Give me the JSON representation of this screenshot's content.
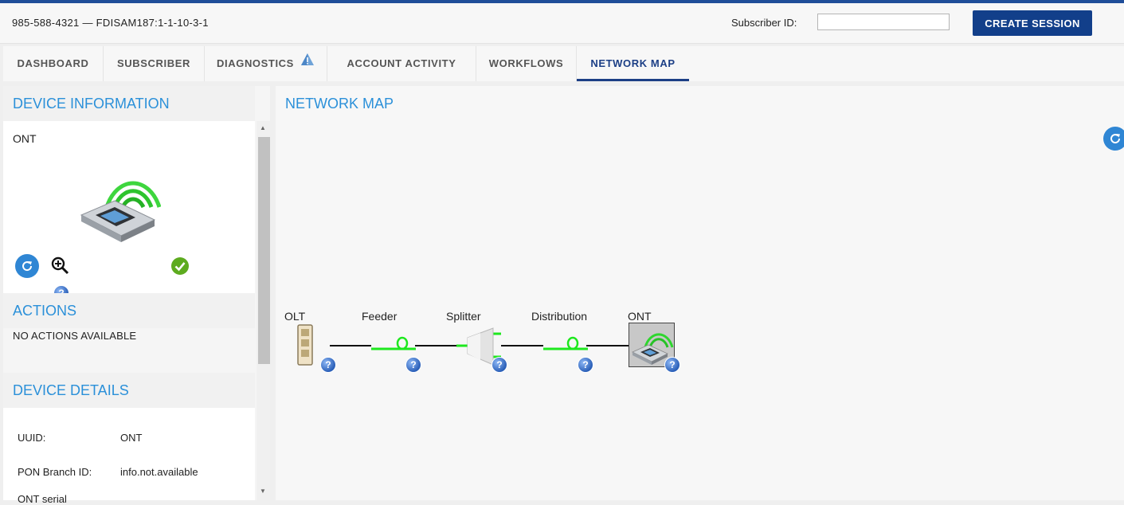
{
  "header": {
    "context_text": "985-588-4321 — FDISAM187:1-1-10-3-1",
    "subscriber_id_label": "Subscriber ID:",
    "subscriber_id_value": "",
    "create_session_label": "CREATE SESSION"
  },
  "tabs": [
    {
      "label": "DASHBOARD"
    },
    {
      "label": "SUBSCRIBER"
    },
    {
      "label": "DIAGNOSTICS"
    },
    {
      "label": "ACCOUNT ACTIVITY"
    },
    {
      "label": "WORKFLOWS"
    },
    {
      "label": "NETWORK MAP",
      "active": true
    }
  ],
  "device_information": {
    "title": "DEVICE INFORMATION",
    "device_name": "ONT",
    "status": "ok"
  },
  "actions": {
    "title": "ACTIONS",
    "empty_text": "NO ACTIONS AVAILABLE"
  },
  "device_details": {
    "title": "DEVICE DETAILS",
    "rows": [
      {
        "label": "UUID:",
        "value": "ONT"
      },
      {
        "label": "PON Branch ID:",
        "value": "info.not.available"
      },
      {
        "label": "ONT serial",
        "value": ""
      }
    ]
  },
  "network_map": {
    "title": "NETWORK MAP",
    "nodes": [
      {
        "label": "OLT",
        "icon": "olt-icon"
      },
      {
        "label": "Feeder",
        "icon": "fiber-loop-icon"
      },
      {
        "label": "Splitter",
        "icon": "splitter-icon"
      },
      {
        "label": "Distribution",
        "icon": "fiber-loop-icon"
      },
      {
        "label": "ONT",
        "icon": "ont-icon"
      }
    ]
  },
  "colors": {
    "accent": "#2b90d9",
    "brand": "#123f8a",
    "active_tab": "#1c3f86",
    "fiber_green": "#1ee81e",
    "ok_green": "#5dab1f"
  }
}
